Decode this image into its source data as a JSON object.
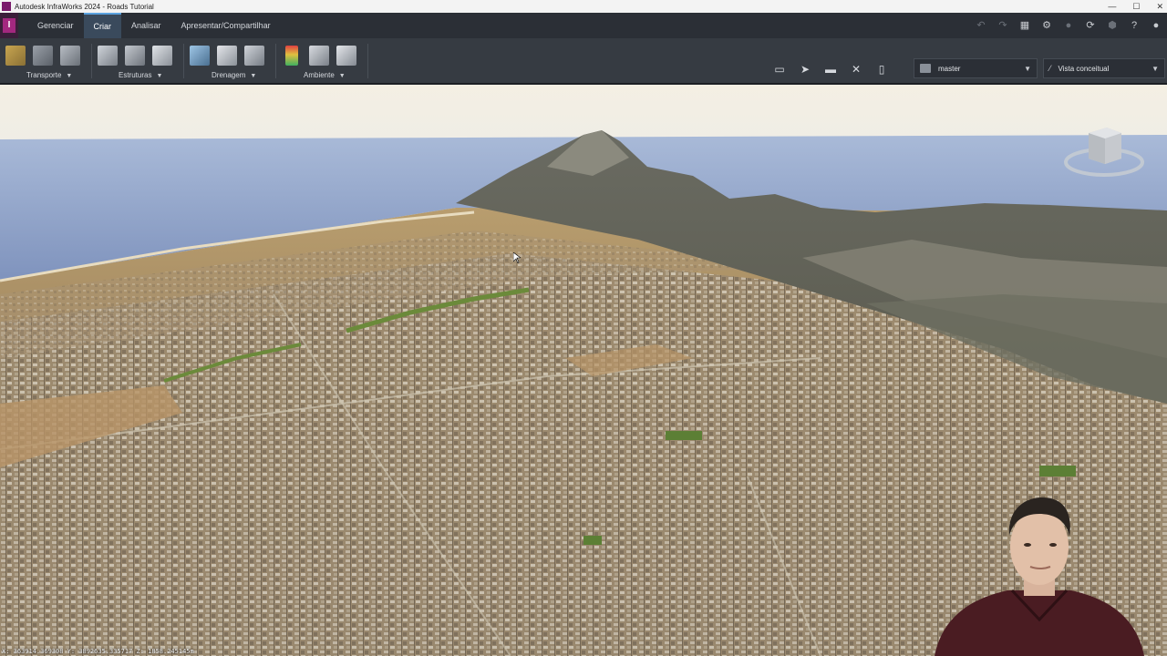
{
  "window": {
    "title": "Autodesk InfraWorks 2024 - Roads Tutorial",
    "controls": [
      "—",
      "☐",
      "✕"
    ]
  },
  "tabs": [
    {
      "label": "Gerenciar",
      "active": false
    },
    {
      "label": "Criar",
      "active": true
    },
    {
      "label": "Analisar",
      "active": false
    },
    {
      "label": "Apresentar/Compartilhar",
      "active": false
    }
  ],
  "ribbon": {
    "groups": [
      {
        "label": "Transporte",
        "icons": [
          "road-icon",
          "railway-icon",
          "pipeline-road-icon"
        ]
      },
      {
        "label": "Estruturas",
        "icons": [
          "bridge-icon",
          "tunnel-icon",
          "building-icon"
        ]
      },
      {
        "label": "Drenagem",
        "icons": [
          "culvert-icon",
          "pipe-icon",
          "inlet-icon"
        ]
      },
      {
        "label": "Ambiente",
        "icons": [
          "traffic-light-icon",
          "tree-icon",
          "sign-icon"
        ]
      }
    ],
    "proposal": "master",
    "style": "Vista conceitual"
  },
  "colors": {
    "ribbon_bg": "#363b42",
    "tabbar_bg": "#2b2f36",
    "active_tab": "#3a4a5c",
    "accent": "#5aa2e0",
    "app_brand": "#a3287f"
  },
  "viewport": {
    "coordinates": "X: 363914.369308 Y: 3892635.335717 Z: 1858.245145m"
  }
}
